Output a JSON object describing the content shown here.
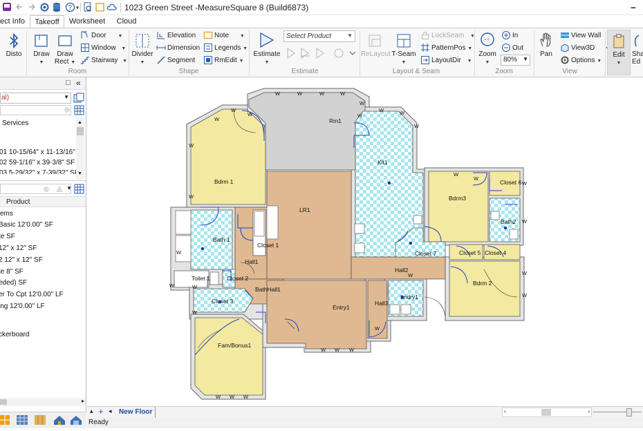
{
  "window": {
    "title": "1023 Green Street -MeasureSquare 8 (Build6873)",
    "minimize_glyph": "–"
  },
  "quick_access": {
    "icons": [
      "purple-app-icon",
      "undo-icon",
      "redo-icon",
      "settings-gear-icon",
      "database-icon",
      "help-icon",
      "print-preview-icon",
      "note-icon",
      "cloud-icon"
    ],
    "help_glyph": "?",
    "dropdown_glyph": "▾"
  },
  "tabs": [
    {
      "label": "ect Info",
      "active": false
    },
    {
      "label": "Takeoff",
      "active": true
    },
    {
      "label": "Worksheet",
      "active": false
    },
    {
      "label": "Cloud",
      "active": false
    }
  ],
  "ribbon": {
    "groups": {
      "room": "Room",
      "shape": "Shape",
      "estimate": "Estimate",
      "layout_seam": "Layout & Seam",
      "zoom": "Zoom",
      "view": "View"
    },
    "buttons": {
      "disto": "Disto",
      "draw": "Draw",
      "draw_rect_line1": "Draw",
      "draw_rect_line2": "Rect",
      "door": "Door",
      "window": "Window",
      "stairway": "Stairway",
      "divider": "Divider",
      "elevation": "Elevation",
      "dimension": "Dimension",
      "segment": "Segment",
      "note": "Note",
      "legends": "Legends",
      "rmedit": "RmEdit",
      "estimate": "Estimate",
      "select_product": "Select Product",
      "relayout": "ReLayout",
      "tseam": "T-Seam",
      "lockseam": "LockSeam",
      "patternpos": "PatternPos",
      "layoutdir": "LayoutDir",
      "zoom": "Zoom",
      "zoom_in": "In",
      "zoom_out": "Out",
      "zoom_level": "80%",
      "pan": "Pan",
      "view_wall": "View Wall",
      "view3d": "View3D",
      "options": "Options",
      "edit": "Edit",
      "share_edit_line1": "Sha",
      "share_edit_line2": "Ed"
    }
  },
  "left_panel": {
    "panel_controls": [
      "restore-icon",
      "collapse-icon"
    ],
    "pin_glyph": "□",
    "collapse_glyph": "«",
    "dropdown_value": "al)",
    "tree_items": [
      "Services",
      "01 10-15/64\" x 11-13/16\"",
      "02 59-1/16\" x 39-3/8\" SF",
      "03 5-29/32\" x 7-39/32\" SF"
    ],
    "product_header": "Product",
    "product_items": [
      "ems",
      "Basic 12'0.00\" SF",
      "te  SF",
      " 12\" x 12\" SF",
      "2 12\" x 12\" SF",
      "te 8\" SF",
      "eded)  SF",
      "er To Cpt 12'0.00\" LF",
      "ing 12'0.00\" LF",
      "ckerboard"
    ]
  },
  "floor_plan": {
    "rooms": [
      {
        "id": "bdrm1",
        "label": "Bdrm 1",
        "type": "carpet"
      },
      {
        "id": "rm1",
        "label": "Rm1",
        "type": "concrete"
      },
      {
        "id": "kit1",
        "label": "Kit1",
        "type": "tile"
      },
      {
        "id": "closet6",
        "label": "Closet 6",
        "type": "carpet"
      },
      {
        "id": "bdrm3",
        "label": "Bdrm3",
        "type": "carpet"
      },
      {
        "id": "bath2",
        "label": "Bath2",
        "type": "tile"
      },
      {
        "id": "lr1",
        "label": "LR1",
        "type": "wood"
      },
      {
        "id": "bath1",
        "label": "Bath 1",
        "type": "tile"
      },
      {
        "id": "closet1",
        "label": "Closet 1",
        "type": "none"
      },
      {
        "id": "hall1",
        "label": "Hall1",
        "type": "wood"
      },
      {
        "id": "closet7",
        "label": "Closet 7",
        "type": "tile"
      },
      {
        "id": "closet5",
        "label": "Closet 5",
        "type": "carpet"
      },
      {
        "id": "closet4",
        "label": "Closet 4",
        "type": "carpet"
      },
      {
        "id": "hall2",
        "label": "Hall2",
        "type": "wood"
      },
      {
        "id": "toilet1",
        "label": "Toilet 1",
        "type": "none"
      },
      {
        "id": "closet2",
        "label": "Closet 2",
        "type": "tile"
      },
      {
        "id": "bathhall1",
        "label": "BathHall1",
        "type": "wood"
      },
      {
        "id": "bdrm2",
        "label": "Bdrm 2",
        "type": "carpet"
      },
      {
        "id": "closet3",
        "label": "Closet 3",
        "type": "tile"
      },
      {
        "id": "entry1",
        "label": "Entry1",
        "type": "wood"
      },
      {
        "id": "hall3",
        "label": "Hall3",
        "type": "wood"
      },
      {
        "id": "lndry1",
        "label": "Lndry1",
        "type": "tile"
      },
      {
        "id": "fambonus1",
        "label": "Fam/Bonus1",
        "type": "carpet"
      }
    ],
    "window_marker": "W"
  },
  "bottom": {
    "floor_tab": "New Floor",
    "add_glyph": "+",
    "nav_left_glyph": "▴",
    "nav_right_glyph": "◂",
    "status": "Ready"
  },
  "colors": {
    "carpet": "#f3e9a0",
    "wood": "#dfb992",
    "concrete": "#d2d2d2",
    "tile_a": "#ffffff",
    "tile_b": "#a7e6ee",
    "wall": "#e4e4e4",
    "door": "#2244cc",
    "accent_tab": "#1a4f9c"
  }
}
